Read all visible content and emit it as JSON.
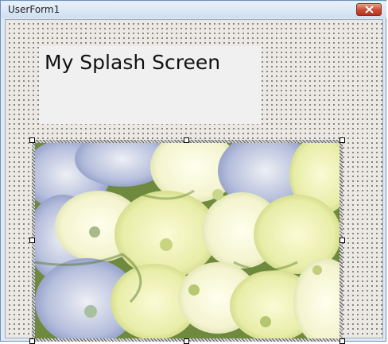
{
  "window": {
    "title": "UserForm1",
    "close_icon": "close-icon"
  },
  "form": {
    "label_caption": "My Splash Screen",
    "image_description_icon": "hydrangea-photo"
  },
  "colors": {
    "titlebar": "#d6e4f2",
    "close_button": "#c94a34",
    "form_background": "#ece9e4",
    "label_background": "#f0f0f0"
  }
}
